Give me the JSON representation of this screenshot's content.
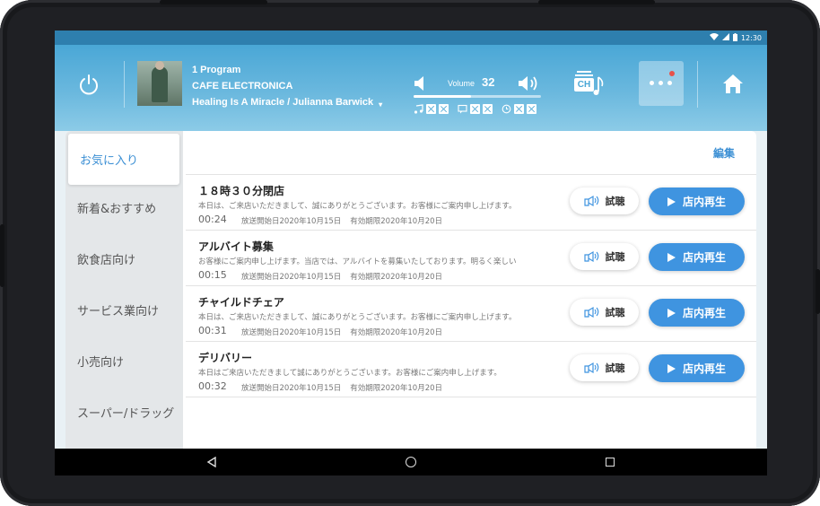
{
  "status_bar": {
    "time": "12:30"
  },
  "player": {
    "program": "1 Program",
    "channel_name": "CAFE ELECTRONICA",
    "track": "Healing Is A Miracle / Julianna Barwick",
    "volume_label": "Volume",
    "volume_value": "32",
    "volume_level_percent": 45,
    "ch_button_label": "CH"
  },
  "colors": {
    "accent": "#3f94e0",
    "header_top": "#4aa7d6",
    "header_bottom": "#8ccbe7",
    "badge_red": "#e8524a"
  },
  "sidebar": {
    "items": [
      {
        "label": "お気に入り",
        "active": true
      },
      {
        "label": "新着&おすすめ",
        "active": false
      },
      {
        "label": "飲食店向け",
        "active": false
      },
      {
        "label": "サービス業向け",
        "active": false
      },
      {
        "label": "小売向け",
        "active": false
      },
      {
        "label": "スーパー/ドラッグ",
        "active": false
      }
    ]
  },
  "list": {
    "edit_label": "編集",
    "trial_label": "試聴",
    "play_label": "店内再生",
    "items": [
      {
        "title": "１８時３０分閉店",
        "body": "本日は、ご来店いただきまして、誠にありがとうございます。お客様にご案内申し上げます。",
        "duration": "00:24",
        "start": "放送開始日2020年10月15日",
        "expiry": "有効期限2020年10月20日"
      },
      {
        "title": "アルバイト募集",
        "body": "お客様にご案内申し上げます。当店では、アルバイトを募集いたしております。明るく楽しい",
        "duration": "00:15",
        "start": "放送開始日2020年10月15日",
        "expiry": "有効期限2020年10月20日"
      },
      {
        "title": "チャイルドチェア",
        "body": "本日は、ご来店いただきまして、誠にありがとうございます。お客様にご案内申し上げます。",
        "duration": "00:31",
        "start": "放送開始日2020年10月15日",
        "expiry": "有効期限2020年10月20日"
      },
      {
        "title": "デリバリー",
        "body": "本日はご来店いただきまして誠にありがとうございます。お客様にご案内申し上げます。",
        "duration": "00:32",
        "start": "放送開始日2020年10月15日",
        "expiry": "有効期限2020年10月20日"
      }
    ]
  }
}
